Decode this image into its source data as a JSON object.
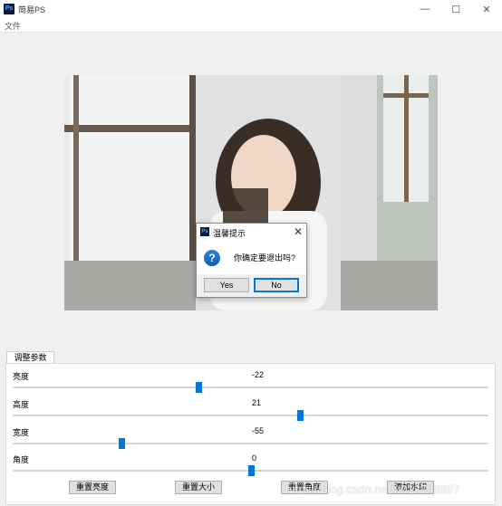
{
  "window": {
    "icon_text": "Ps",
    "title": "简易PS",
    "minimize_glyph": "—",
    "maximize_glyph": "☐",
    "close_glyph": "✕"
  },
  "menu": {
    "file": "文件"
  },
  "dialog": {
    "icon_text": "Ps",
    "title": "温馨提示",
    "close_glyph": "✕",
    "question_glyph": "?",
    "message": "你确定要退出吗?",
    "yes_label": "Yes",
    "no_label": "No"
  },
  "panel": {
    "tab_label": "调整参数",
    "sliders": [
      {
        "label": "亮度",
        "value": "-22"
      },
      {
        "label": "高度",
        "value": "21"
      },
      {
        "label": "宽度",
        "value": "-55"
      },
      {
        "label": "角度",
        "value": "0"
      }
    ],
    "buttons": [
      "重置亮度",
      "重置大小",
      "重置角度",
      "添加水印"
    ]
  },
  "watermark": "https://blog.csdn.net/u013748897"
}
